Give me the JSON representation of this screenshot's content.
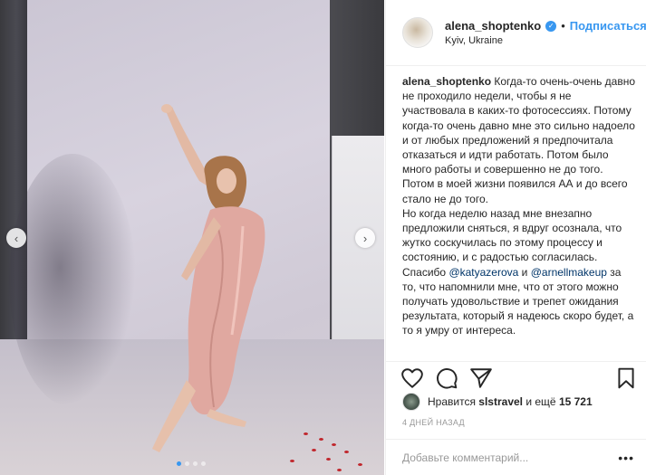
{
  "post": {
    "username": "alena_shoptenko",
    "follow_label": "Подписаться",
    "separator": "•",
    "location": "Kyiv, Ukraine",
    "caption_user": "alena_shoptenko",
    "caption_part1": "Когда-то очень-очень давно не проходило недели, чтобы я не участвовала в каких-то фотосессиях. Потому когда-то очень давно мне это сильно надоело и от любых предложений я предпочитала отказаться и идти работать. Потом было много работы и совершенно не до того. Потом в моей жизни появился АА и до всего стало не до того.",
    "caption_part2": "Но когда неделю назад мне внезапно предложили сняться, я вдруг осознала, что жутко соскучилась по этому процессу и состоянию, и с радостью согласилась.",
    "caption_part3_a": "Спасибо",
    "mention_1": "@katyazerova",
    "caption_part3_b": "и",
    "mention_2": "@arnellmakeup",
    "caption_part3_c": "за то, что напомнили мне, что от этого можно получать удовольствие и трепет ожидания результата, который я надеюсь скоро будет, а то я умру от интереса."
  },
  "likes": {
    "prefix": "Нравится",
    "user": "slstravel",
    "middle": "и ещё",
    "count": "15 721"
  },
  "timestamp": "4 ДНЕЙ НАЗАД",
  "comment": {
    "placeholder": "Добавьте комментарий...",
    "more": "•••"
  },
  "carousel": {
    "prev": "‹",
    "next": "›",
    "slide_count": 4,
    "active_index": 0
  },
  "colors": {
    "accent": "#3897f0",
    "text": "#262626",
    "muted": "#999999",
    "mention": "#003569",
    "border": "#efefef"
  },
  "icons": [
    "heart-icon",
    "comment-icon",
    "share-icon",
    "bookmark-icon",
    "verified-icon"
  ]
}
